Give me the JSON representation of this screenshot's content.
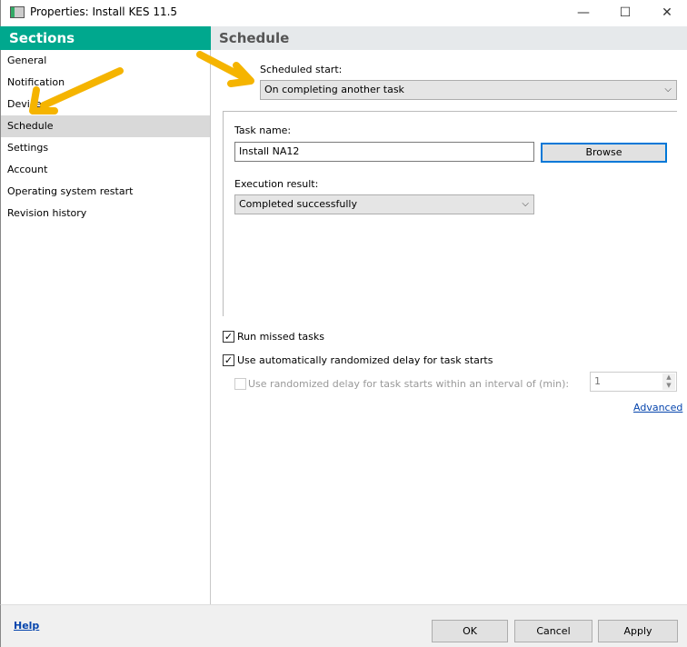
{
  "window": {
    "title": "Properties: Install KES 11.5",
    "minimize": "—",
    "maximize": "☐",
    "close": "✕"
  },
  "sidebar": {
    "header": "Sections",
    "items": [
      {
        "label": "General"
      },
      {
        "label": "Notification"
      },
      {
        "label": "Devices"
      },
      {
        "label": "Schedule",
        "selected": true
      },
      {
        "label": "Settings"
      },
      {
        "label": "Account"
      },
      {
        "label": "Operating system restart"
      },
      {
        "label": "Revision history"
      }
    ]
  },
  "main": {
    "header": "Schedule",
    "scheduled_start": {
      "label": "Scheduled start:",
      "value": "On completing another task"
    },
    "task_name": {
      "label": "Task name:",
      "value": "Install NA12",
      "browse": "Browse"
    },
    "execution_result": {
      "label": "Execution result:",
      "value": "Completed successfully"
    },
    "run_missed": {
      "label": "Run missed tasks",
      "checked": true
    },
    "auto_delay": {
      "label": "Use automatically randomized delay for task starts",
      "checked": true
    },
    "interval_delay": {
      "label": "Use randomized delay for task starts within an interval of (min):",
      "checked": false,
      "value": "1"
    },
    "advanced": "Advanced"
  },
  "footer": {
    "help": "Help",
    "ok": "OK",
    "cancel": "Cancel",
    "apply": "Apply"
  },
  "colors": {
    "accent": "#00a88e",
    "arrow": "#f5b400"
  }
}
